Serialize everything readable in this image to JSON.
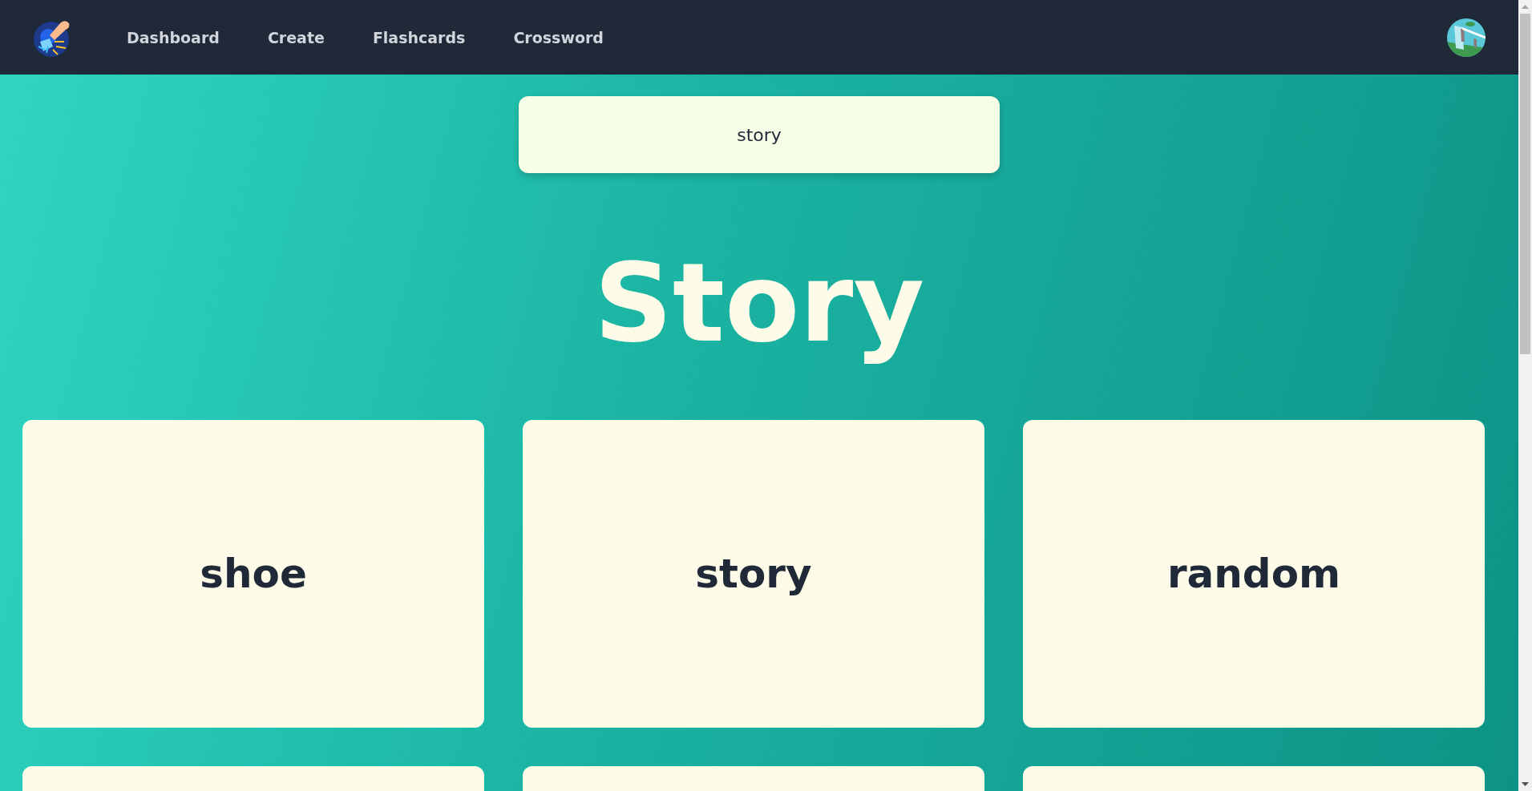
{
  "nav": {
    "items": [
      {
        "label": "Dashboard"
      },
      {
        "label": "Create"
      },
      {
        "label": "Flashcards"
      },
      {
        "label": "Crossword"
      }
    ]
  },
  "search": {
    "value": "story"
  },
  "heading": "Story",
  "cards": [
    {
      "kind": "word",
      "word": "shoe"
    },
    {
      "kind": "word",
      "word": "story"
    },
    {
      "kind": "word",
      "word": "random"
    },
    {
      "kind": "cut"
    },
    {
      "kind": "cut"
    },
    {
      "kind": "cut"
    }
  ]
}
